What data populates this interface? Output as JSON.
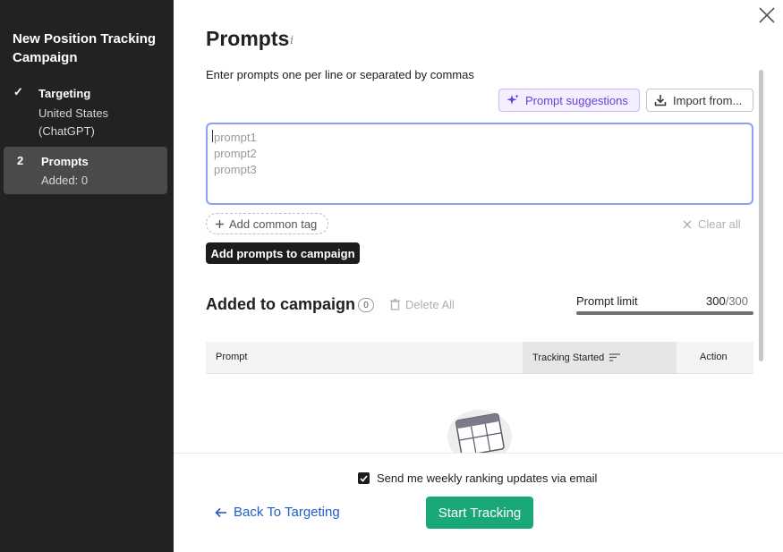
{
  "sidebar": {
    "title": "New Position Tracking Campaign",
    "steps": [
      {
        "marker": "✓",
        "label": "Targeting",
        "sub": "United States (ChatGPT)"
      },
      {
        "marker": "2",
        "label": "Prompts",
        "sub": "Added: 0"
      }
    ]
  },
  "main": {
    "title": "Prompts",
    "info_glyph": "i",
    "instructions": "Enter prompts one per line or separated by commas",
    "suggestions_label": "Prompt suggestions",
    "import_label": "Import from...",
    "prompt_placeholder": "prompt1\nprompt2\nprompt3",
    "add_tag_label": "Add common tag",
    "clear_all_label": "Clear all",
    "add_prompts_label": "Add prompts to campaign",
    "added_title": "Added to campaign",
    "added_count": "0",
    "delete_all_label": "Delete All",
    "limit_label": "Prompt limit",
    "limit_used": "300",
    "limit_max": "/300",
    "limit_fraction": 1.0,
    "table_headers": {
      "prompt": "Prompt",
      "tracking": "Tracking Started",
      "action": "Action"
    }
  },
  "footer": {
    "weekly_label": "Send me weekly ranking updates via email",
    "weekly_checked": true,
    "back_label": "Back To Targeting",
    "start_label": "Start Tracking"
  },
  "colors": {
    "sidebar_bg": "#222222",
    "accent_purple": "#6a3ee0",
    "start_green": "#1aa87b",
    "link_blue": "#1f5fc9",
    "focus_border": "#8d9ef3"
  }
}
